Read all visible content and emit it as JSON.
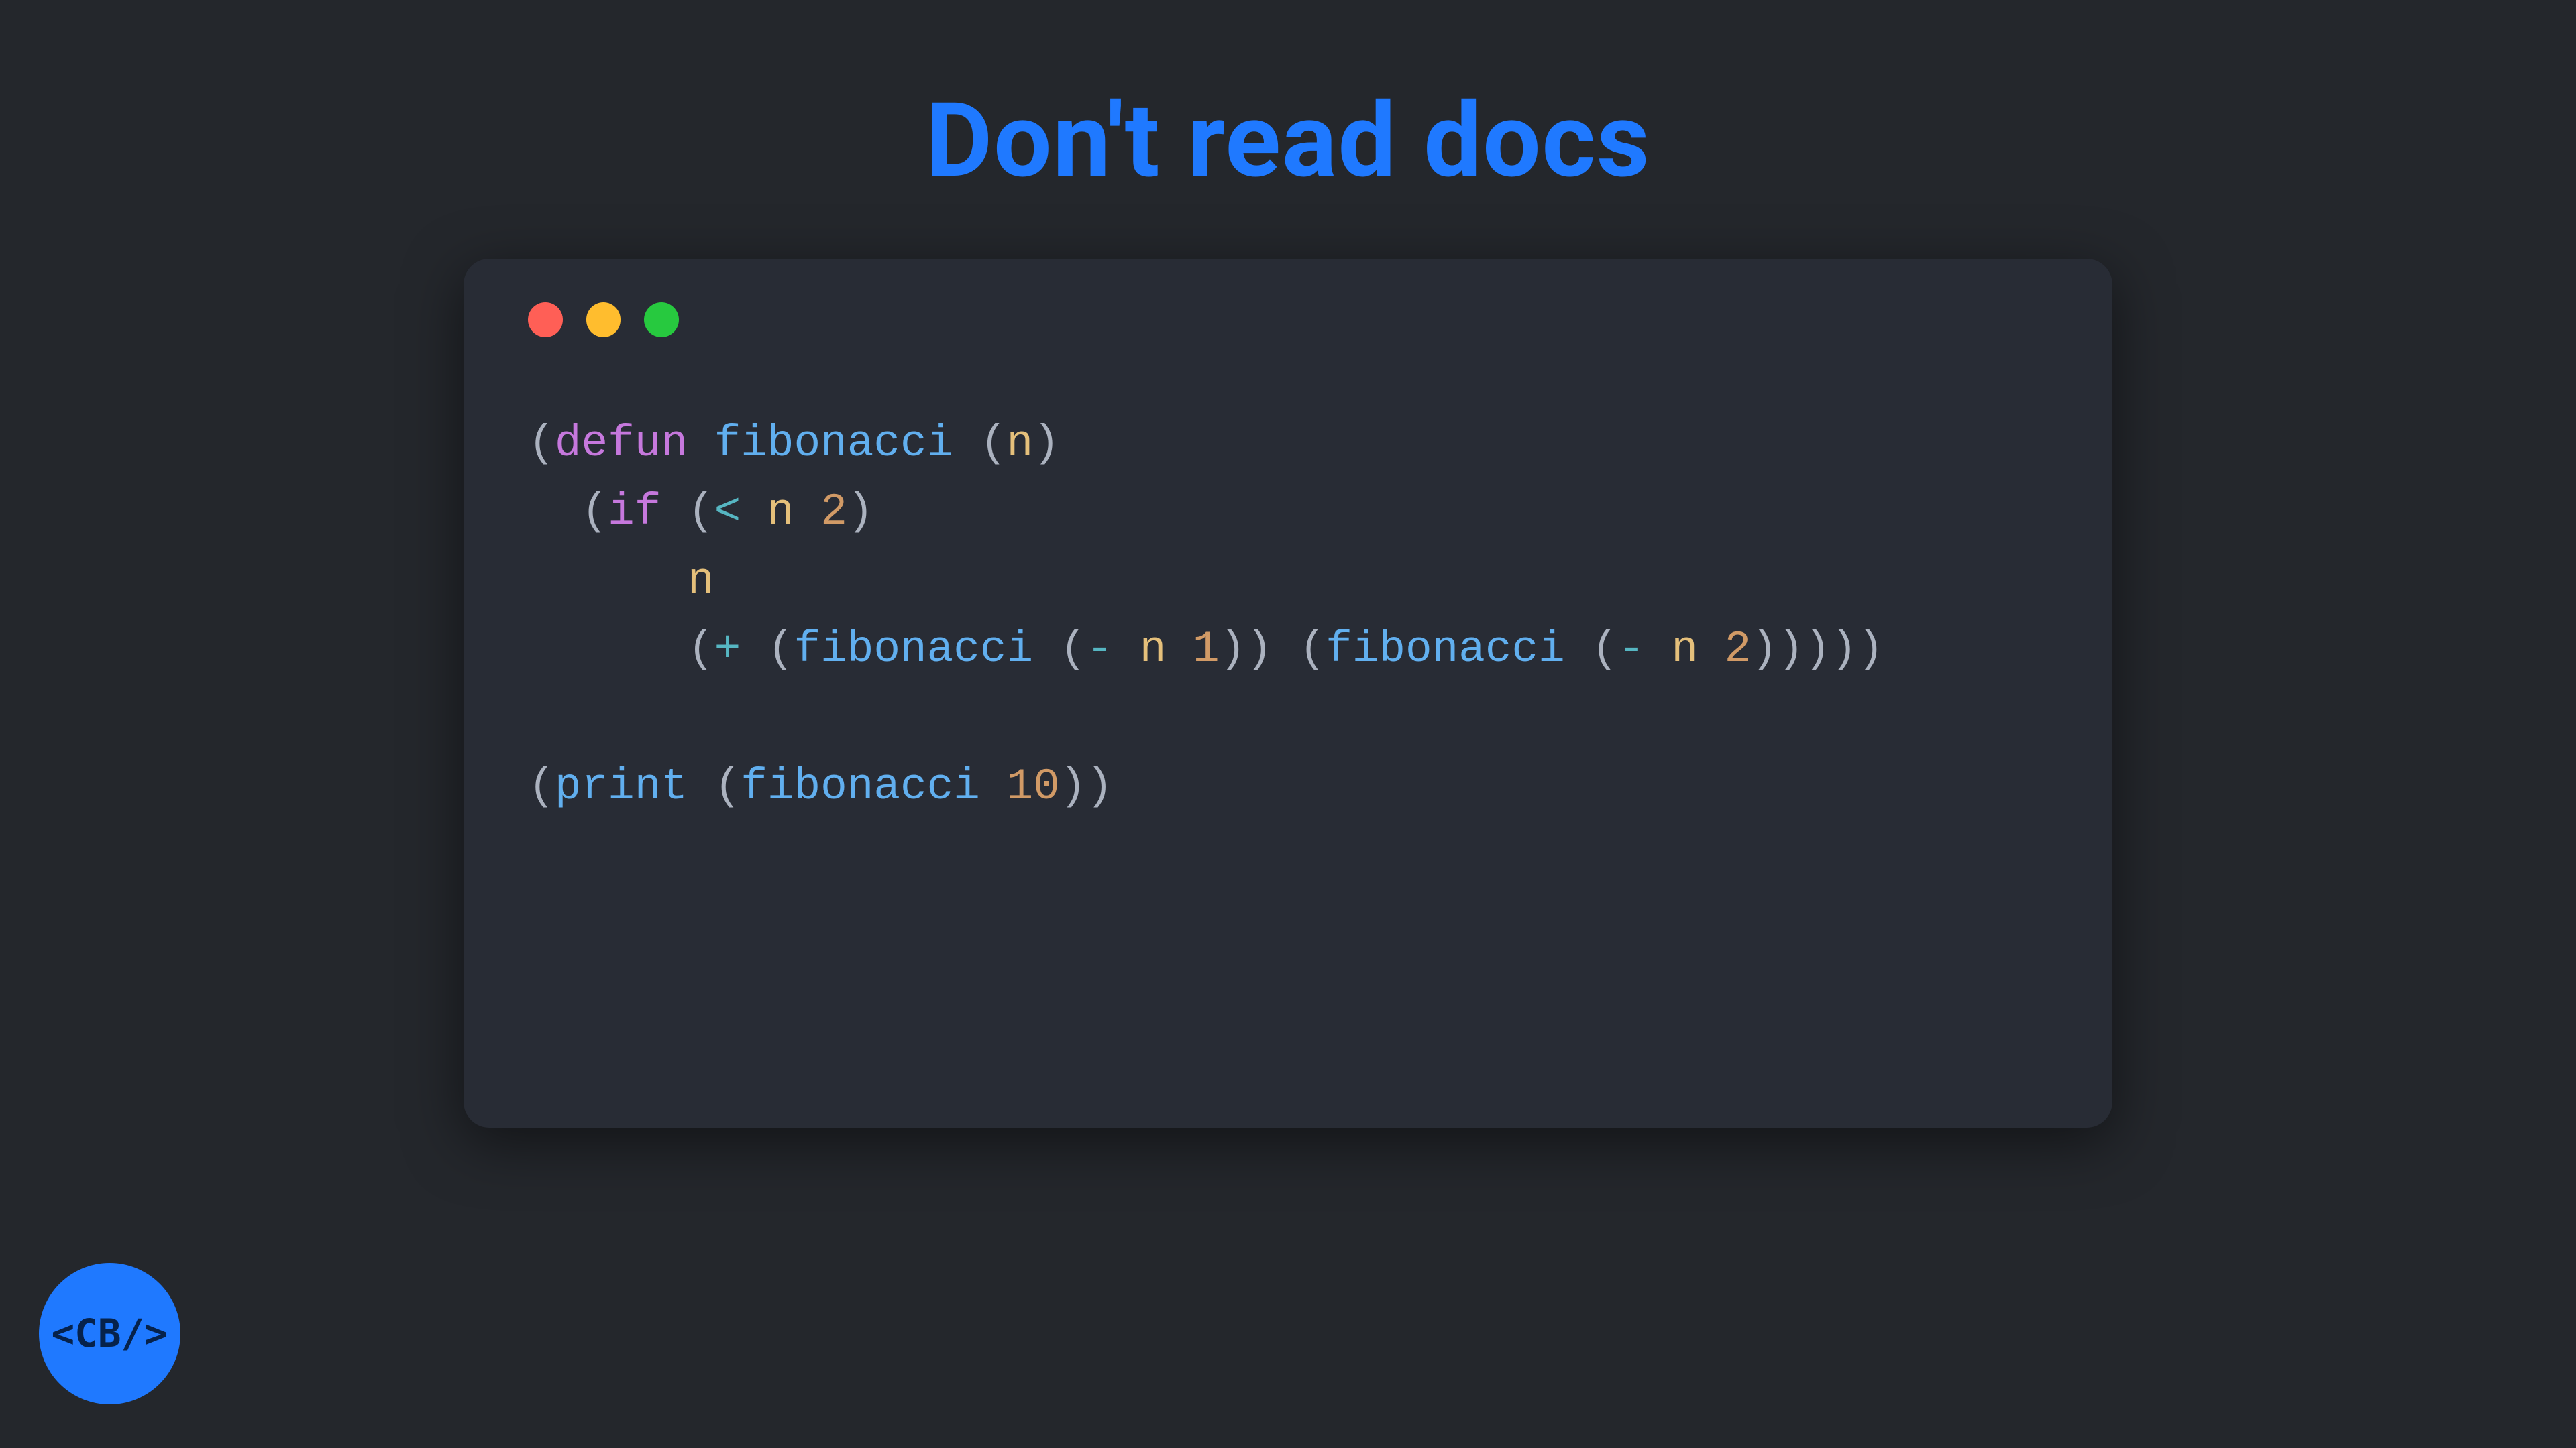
{
  "slide": {
    "title": "Don't read docs"
  },
  "traffic_lights": {
    "red": "#FF5F56",
    "yellow": "#FFBD2E",
    "green": "#27C93F"
  },
  "code": {
    "language": "lisp",
    "plain": "(defun fibonacci (n)\n  (if (< n 2)\n      n\n      (+ (fibonacci (- n 1)) (fibonacci (- n 2)))))\n\n(print (fibonacci 10))",
    "lines": [
      [
        {
          "t": "paren",
          "s": "("
        },
        {
          "t": "keyword",
          "s": "defun"
        },
        {
          "t": "paren",
          "s": " "
        },
        {
          "t": "func",
          "s": "fibonacci"
        },
        {
          "t": "paren",
          "s": " ("
        },
        {
          "t": "var",
          "s": "n"
        },
        {
          "t": "paren",
          "s": ")"
        }
      ],
      [
        {
          "t": "paren",
          "s": "  ("
        },
        {
          "t": "keyword",
          "s": "if"
        },
        {
          "t": "paren",
          "s": " ("
        },
        {
          "t": "op",
          "s": "<"
        },
        {
          "t": "paren",
          "s": " "
        },
        {
          "t": "var",
          "s": "n"
        },
        {
          "t": "paren",
          "s": " "
        },
        {
          "t": "num",
          "s": "2"
        },
        {
          "t": "paren",
          "s": ")"
        }
      ],
      [
        {
          "t": "paren",
          "s": "      "
        },
        {
          "t": "var",
          "s": "n"
        }
      ],
      [
        {
          "t": "paren",
          "s": "      ("
        },
        {
          "t": "op",
          "s": "+"
        },
        {
          "t": "paren",
          "s": " ("
        },
        {
          "t": "func",
          "s": "fibonacci"
        },
        {
          "t": "paren",
          "s": " ("
        },
        {
          "t": "op",
          "s": "-"
        },
        {
          "t": "paren",
          "s": " "
        },
        {
          "t": "var",
          "s": "n"
        },
        {
          "t": "paren",
          "s": " "
        },
        {
          "t": "num",
          "s": "1"
        },
        {
          "t": "paren",
          "s": ")) ("
        },
        {
          "t": "func",
          "s": "fibonacci"
        },
        {
          "t": "paren",
          "s": " ("
        },
        {
          "t": "op",
          "s": "-"
        },
        {
          "t": "paren",
          "s": " "
        },
        {
          "t": "var",
          "s": "n"
        },
        {
          "t": "paren",
          "s": " "
        },
        {
          "t": "num",
          "s": "2"
        },
        {
          "t": "paren",
          "s": ")))))"
        }
      ],
      [],
      [
        {
          "t": "paren",
          "s": "("
        },
        {
          "t": "func",
          "s": "print"
        },
        {
          "t": "paren",
          "s": " ("
        },
        {
          "t": "func",
          "s": "fibonacci"
        },
        {
          "t": "paren",
          "s": " "
        },
        {
          "t": "num",
          "s": "10"
        },
        {
          "t": "paren",
          "s": "))"
        }
      ]
    ]
  },
  "logo": {
    "text": "<CB/>"
  },
  "colors": {
    "background": "#24272C",
    "window": "#282C35",
    "accent": "#1F79FF"
  }
}
